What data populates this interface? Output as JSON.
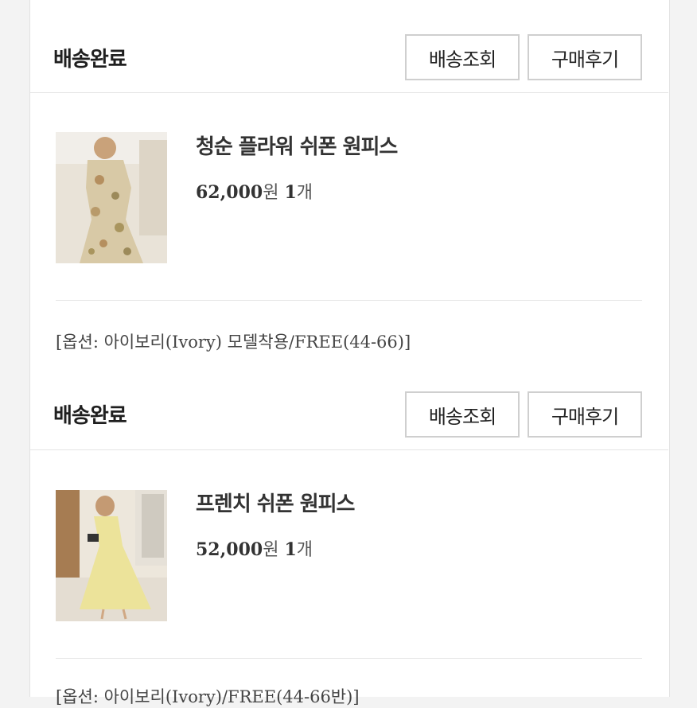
{
  "orders": [
    {
      "status": "배송완료",
      "track_label": "배송조회",
      "review_label": "구매후기",
      "product_name": "청순 플라워 쉬폰 원피스",
      "price": "62,000",
      "price_unit": "원",
      "qty": "1",
      "qty_unit": "개",
      "option": "[옵션: 아이보리(Ivory) 모델착용/FREE(44-66)]",
      "thumb_colors": [
        "#e9e3d8",
        "#d6c8a8"
      ]
    },
    {
      "status": "배송완료",
      "track_label": "배송조회",
      "review_label": "구매후기",
      "product_name": "프렌치 쉬폰 원피스",
      "price": "52,000",
      "price_unit": "원",
      "qty": "1",
      "qty_unit": "개",
      "option": "[옵션: 아이보리(Ivory)/FREE(44-66반)]",
      "thumb_colors": [
        "#ede7dc",
        "#ece39a"
      ]
    }
  ]
}
